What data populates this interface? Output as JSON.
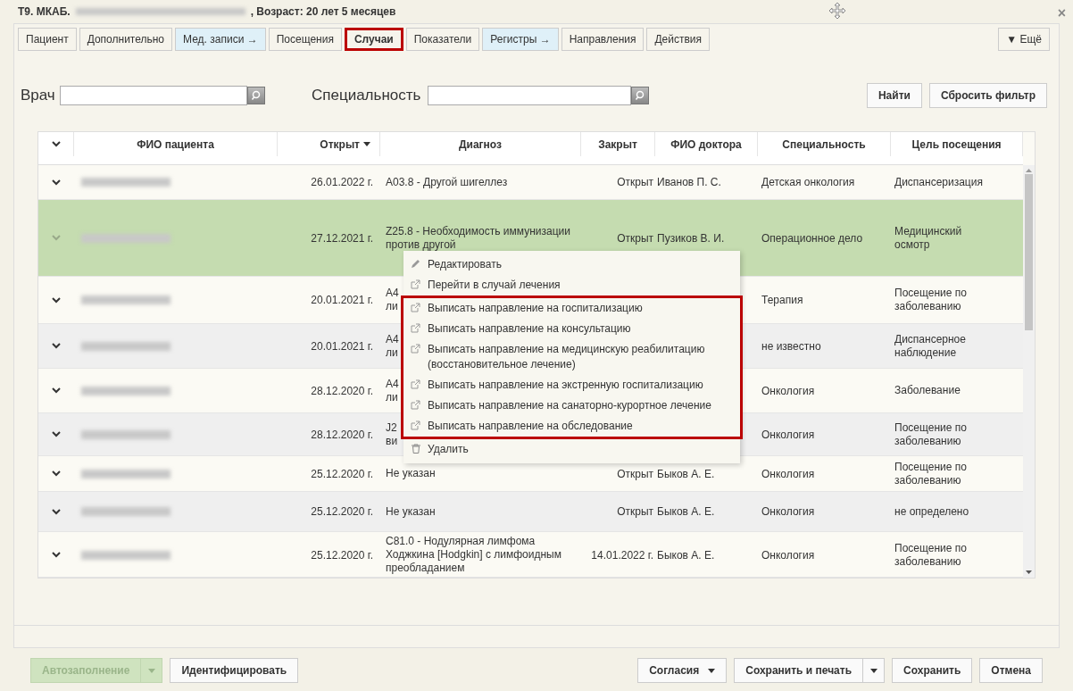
{
  "window": {
    "title_prefix": "Т9. МКАБ.",
    "title_suffix": ", Возраст: 20 лет 5 месяцев",
    "close": "×"
  },
  "tabs": [
    {
      "label": "Пациент",
      "kind": "plain",
      "selected": false,
      "highlighted": false
    },
    {
      "label": "Дополнительно",
      "kind": "plain",
      "selected": false,
      "highlighted": false
    },
    {
      "label": "Мед. записи →",
      "kind": "dropdown",
      "selected": false,
      "highlighted": false
    },
    {
      "label": "Посещения",
      "kind": "plain",
      "selected": false,
      "highlighted": false
    },
    {
      "label": "Случаи",
      "kind": "plain",
      "selected": true,
      "highlighted": true
    },
    {
      "label": "Показатели",
      "kind": "plain",
      "selected": false,
      "highlighted": false
    },
    {
      "label": "Регистры →",
      "kind": "dropdown",
      "selected": false,
      "highlighted": false
    },
    {
      "label": "Направления",
      "kind": "plain",
      "selected": false,
      "highlighted": false
    },
    {
      "label": "Действия",
      "kind": "plain",
      "selected": false,
      "highlighted": false
    }
  ],
  "more_tab": "▼ Ещё",
  "filters": [
    {
      "label": "Врач"
    },
    {
      "label": "Специальность"
    }
  ],
  "filter_buttons": [
    "Найти",
    "Сбросить фильтр"
  ],
  "table": {
    "columns": [
      "ФИО пациента",
      "Открыт",
      "Диагноз",
      "Закрыт",
      "ФИО доктора",
      "Специальность",
      "Цель посещения"
    ],
    "rows": [
      {
        "selected": false,
        "opened": "26.01.2022 г.",
        "diagnosis": "А03.8 - Другой шигеллез",
        "closed": "Открыт",
        "doctor": "Иванов П. С.",
        "specialty": "Детская онкология",
        "purpose": "Диспансеризация"
      },
      {
        "selected": true,
        "opened": "27.12.2021 г.",
        "diagnosis": "Z25.8 - Необходимость иммунизации против другой",
        "closed": "Открыт",
        "doctor": "Пузиков В. И.",
        "specialty": "Операционное дело",
        "purpose": "Медицинский осмотр"
      },
      {
        "selected": false,
        "opened": "20.01.2021 г.",
        "diagnosis": "А4 ли",
        "specialty": "Терапия",
        "purpose": "Посещение по заболеванию"
      },
      {
        "selected": false,
        "opened": "20.01.2021 г.",
        "diagnosis": "А4 ли",
        "specialty": "не известно",
        "purpose": "Диспансерное наблюдение"
      },
      {
        "selected": false,
        "opened": "28.12.2020 г.",
        "diagnosis": "А4 ли",
        "specialty": "Онкология",
        "purpose": "Заболевание"
      },
      {
        "selected": false,
        "opened": "28.12.2020 г.",
        "diagnosis": "J2 ви",
        "specialty": "Онкология",
        "purpose": "Посещение по заболеванию"
      },
      {
        "selected": false,
        "opened": "25.12.2020 г.",
        "diagnosis": "Не указан",
        "closed": "Открыт",
        "doctor": "Быков А. Е.",
        "specialty": "Онкология",
        "purpose": "Посещение по заболеванию"
      },
      {
        "selected": false,
        "opened": "25.12.2020 г.",
        "diagnosis": "Не указан",
        "closed": "Открыт",
        "doctor": "Быков А. Е.",
        "specialty": "Онкология",
        "purpose": "не определено"
      },
      {
        "selected": false,
        "opened": "25.12.2020 г.",
        "diagnosis": "C81.0 - Нодулярная лимфома Ходжкина [Hodgkin] с лимфоидным преобладанием",
        "closed": "14.01.2022 г.",
        "doctor": "Быков А. Е.",
        "specialty": "Онкология",
        "purpose": "Посещение по заболеванию"
      }
    ]
  },
  "context_menu": {
    "items": [
      {
        "label": "Редактировать",
        "kind": "edit",
        "highlighted": false
      },
      {
        "label": "Перейти в случай лечения",
        "kind": "link",
        "highlighted": false
      },
      {
        "label": "Выписать направление на госпитализацию",
        "kind": "link",
        "highlighted": true
      },
      {
        "label": "Выписать направление на консультацию",
        "kind": "link",
        "highlighted": true
      },
      {
        "label": "Выписать направление на медицинскую реабилитацию (восстановительное лечение)",
        "kind": "link",
        "highlighted": true
      },
      {
        "label": "Выписать направление на экстренную госпитализацию",
        "kind": "link",
        "highlighted": true
      },
      {
        "label": "Выписать направление на санаторно-курортное лечение",
        "kind": "link",
        "highlighted": true
      },
      {
        "label": "Выписать направление на обследование",
        "kind": "link",
        "highlighted": true
      },
      {
        "label": "Удалить",
        "kind": "delete",
        "highlighted": false
      }
    ]
  },
  "footer": {
    "left": [
      {
        "label": "Автозаполнение",
        "disabled": true,
        "split": true
      },
      {
        "label": "Идентифицировать",
        "disabled": false,
        "split": false
      }
    ],
    "right": [
      {
        "label": "Согласия",
        "disabled": false,
        "split": false,
        "caret": true
      },
      {
        "label": "Сохранить и печать",
        "disabled": false,
        "split": true
      },
      {
        "label": "Сохранить",
        "disabled": false,
        "split": false
      },
      {
        "label": "Отмена",
        "disabled": false,
        "split": false
      }
    ]
  }
}
